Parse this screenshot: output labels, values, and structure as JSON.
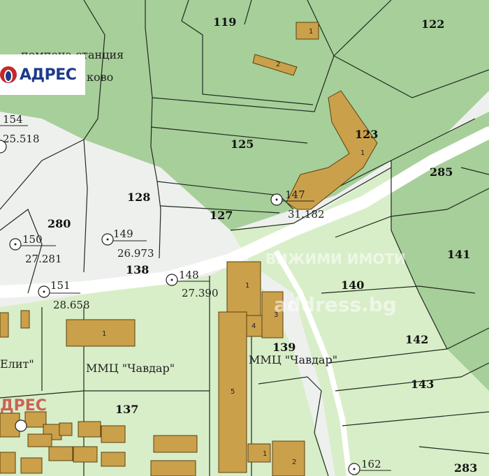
{
  "brand": {
    "logo_text": "АДРЕС",
    "logo_text_partial": "ДРЕС"
  },
  "watermarks": {
    "domain": "address.bg",
    "line": "ВИЖИМИ ИМОТИ"
  },
  "colors": {
    "forest": "#a7cf9a",
    "meadow": "#d8eec8",
    "open": "#eef0ee",
    "building": "#caa04a",
    "building_edge": "#5b4010",
    "road": "#ffffff",
    "line": "#1f2a1f"
  },
  "labels": {
    "p119": "119",
    "p122": "122",
    "p123": "123",
    "p125": "125",
    "p127": "127",
    "p128": "128",
    "p280": "280",
    "p285": "285",
    "p138": "138",
    "p139": "139",
    "p140": "140",
    "p141": "141",
    "p142": "142",
    "p143": "143",
    "p137": "137",
    "p283": "283",
    "pump_station": "помпена станция",
    "place_partial": "ково",
    "n154": "154",
    "e154": "25.518",
    "n150": "150",
    "e150": "27.281",
    "n149": "149",
    "e149": "26.973",
    "n148": "148",
    "e148": "27.390",
    "n151": "151",
    "e151": "28.658",
    "n147": "147",
    "e147": "31.182",
    "n162": "162",
    "clinic1": "ММЦ \"Чавдар\"",
    "clinic2": "ММЦ \"Чавдар\"",
    "elit": "Елит\"",
    "b1": "1",
    "b2": "2",
    "b3": "3",
    "b4": "4",
    "b5": "5"
  }
}
